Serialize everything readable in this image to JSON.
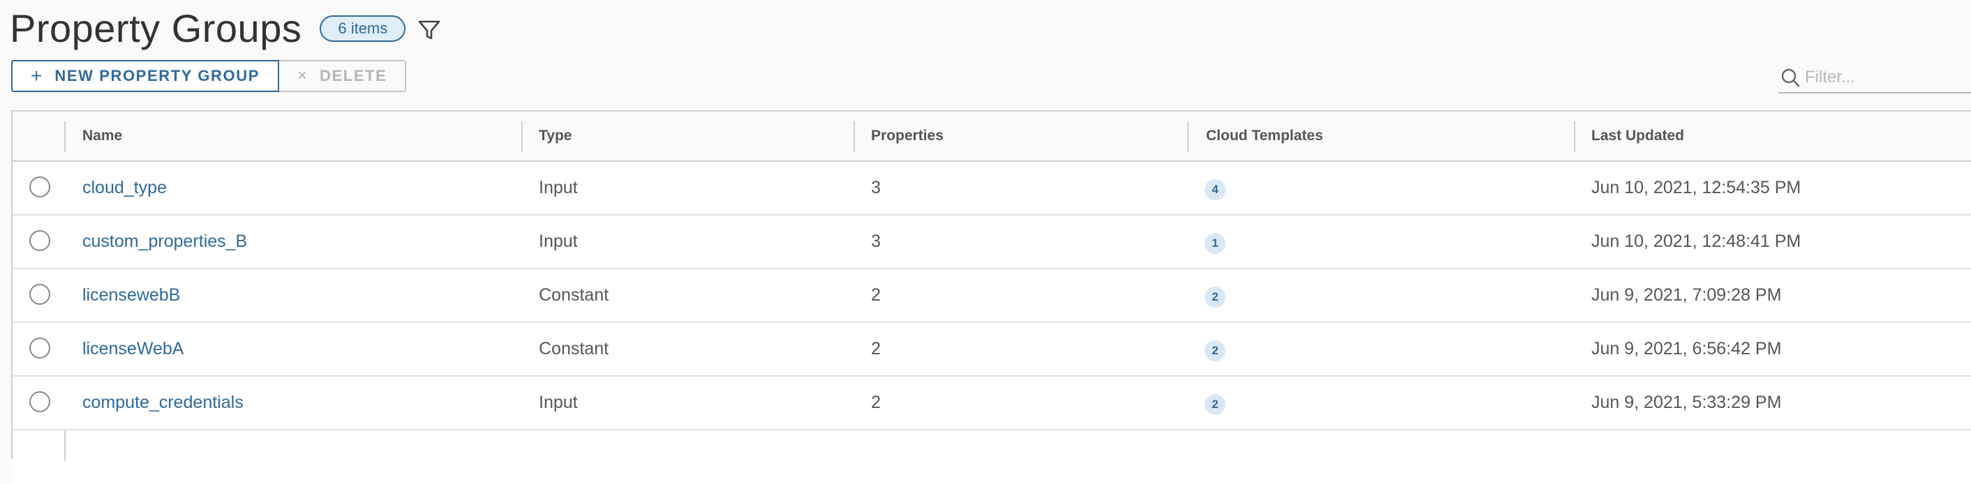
{
  "header": {
    "title": "Property Groups",
    "count_badge": "6 items"
  },
  "toolbar": {
    "new_label": "NEW PROPERTY GROUP",
    "new_icon": "plus-icon",
    "delete_label": "DELETE",
    "delete_icon": "close-icon"
  },
  "filter": {
    "placeholder": "Filter..."
  },
  "table": {
    "columns": [
      "Name",
      "Type",
      "Properties",
      "Cloud Templates",
      "Last Updated"
    ],
    "rows": [
      {
        "name": "cloud_type",
        "type": "Input",
        "properties": "3",
        "cloud_templates": "4",
        "last_updated": "Jun 10, 2021, 12:54:35 PM"
      },
      {
        "name": "custom_properties_B",
        "type": "Input",
        "properties": "3",
        "cloud_templates": "1",
        "last_updated": "Jun 10, 2021, 12:48:41 PM"
      },
      {
        "name": "licensewebB",
        "type": "Constant",
        "properties": "2",
        "cloud_templates": "2",
        "last_updated": "Jun 9, 2021, 7:09:28 PM"
      },
      {
        "name": "licenseWebA",
        "type": "Constant",
        "properties": "2",
        "cloud_templates": "2",
        "last_updated": "Jun 9, 2021, 6:56:42 PM"
      },
      {
        "name": "compute_credentials",
        "type": "Input",
        "properties": "2",
        "cloud_templates": "2",
        "last_updated": "Jun 9, 2021, 5:33:29 PM"
      }
    ]
  },
  "colors": {
    "accent": "#2f6a9b",
    "badge_bg": "#e0eef9",
    "border": "#cfcfcf"
  }
}
